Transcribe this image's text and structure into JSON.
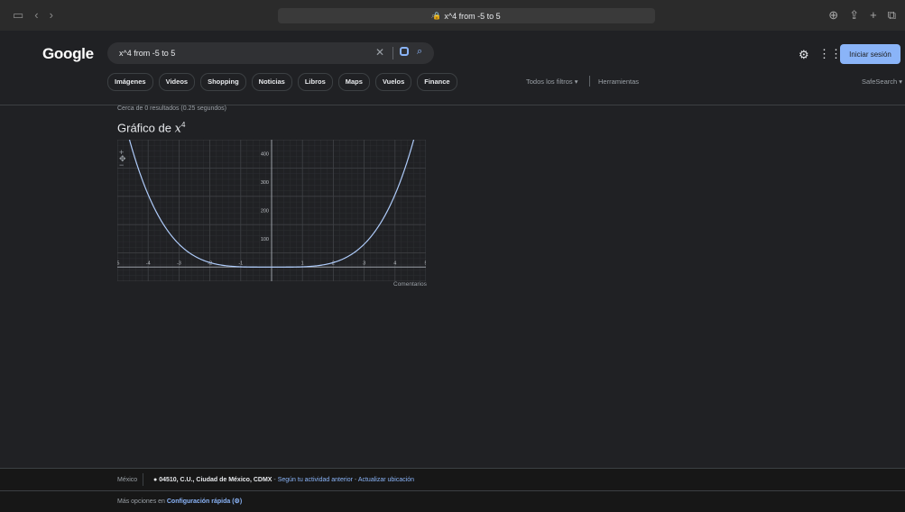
{
  "browser": {
    "url": "x^4 from -5 to 5"
  },
  "google": {
    "logo": "Google",
    "search_value": "x^4 from -5 to 5",
    "signin_label": "Iniciar sesión",
    "tabs": [
      "Imágenes",
      "Videos",
      "Shopping",
      "Noticias",
      "Libros",
      "Maps",
      "Vuelos",
      "Finance"
    ],
    "filters_label": "Todos los filtros",
    "tools_label": "Herramientas",
    "safesearch_label": "SafeSearch"
  },
  "results": {
    "stats": "Cerca de 0 resultados (0.25 segundos)",
    "graph_title_prefix": "Gráfico de",
    "graph_var": "x",
    "graph_exp": "4",
    "feedback": "Comentarios"
  },
  "chart_data": {
    "type": "line",
    "function": "x^4",
    "x_range": [
      -5,
      5
    ],
    "xlim": [
      -5,
      5
    ],
    "ylim": [
      -50,
      450
    ],
    "x_ticks": [
      -5,
      -4,
      -3,
      -2,
      -1,
      1,
      2,
      3,
      4,
      5
    ],
    "y_ticks": [
      100,
      200,
      300,
      400
    ],
    "grid": true,
    "line_color": "#aecbfa"
  },
  "footer": {
    "country": "México",
    "location_bold": "04510, C.U., Ciudad de México, CDMX",
    "location_sep": " - ",
    "location_link1": "Según tu actividad anterior",
    "location_link2": "Actualizar ubicación",
    "more_prefix": "Más opciones en",
    "more_link": "Configuración rápida (⚙)"
  }
}
